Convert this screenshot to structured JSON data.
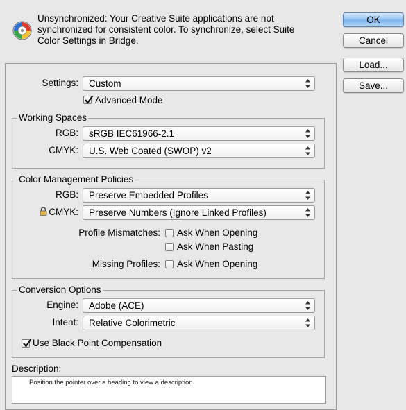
{
  "warning": {
    "icon": "color-wheel-icon",
    "line1": "Unsynchronized: Your Creative Suite applications are not",
    "line2": "synchronized for consistent color. To synchronize, select Suite",
    "line3": "Color Settings in Bridge."
  },
  "buttons": {
    "ok": "OK",
    "cancel": "Cancel",
    "load": "Load...",
    "save": "Save..."
  },
  "settings": {
    "label": "Settings:",
    "value": "Custom",
    "advanced_mode_label": "Advanced Mode",
    "advanced_mode_checked": true
  },
  "working_spaces": {
    "title": "Working Spaces",
    "rgb_label": "RGB:",
    "rgb_value": "sRGB IEC61966-2.1",
    "cmyk_label": "CMYK:",
    "cmyk_value": "U.S. Web Coated (SWOP) v2"
  },
  "policies": {
    "title": "Color Management Policies",
    "rgb_label": "RGB:",
    "rgb_value": "Preserve Embedded Profiles",
    "cmyk_label": "CMYK:",
    "cmyk_value": "Preserve Numbers (Ignore Linked Profiles)",
    "lock_icon": "lock-icon",
    "mismatch_label": "Profile Mismatches:",
    "mismatch_open_label": "Ask When Opening",
    "mismatch_open_checked": false,
    "mismatch_paste_label": "Ask When Pasting",
    "mismatch_paste_checked": false,
    "missing_label": "Missing Profiles:",
    "missing_open_label": "Ask When Opening",
    "missing_open_checked": false
  },
  "conversion": {
    "title": "Conversion Options",
    "engine_label": "Engine:",
    "engine_value": "Adobe (ACE)",
    "intent_label": "Intent:",
    "intent_value": "Relative Colorimetric",
    "bpc_label": "Use Black Point Compensation",
    "bpc_checked": true
  },
  "description": {
    "label": "Description:",
    "text": "Position the pointer over a heading to view a description."
  }
}
